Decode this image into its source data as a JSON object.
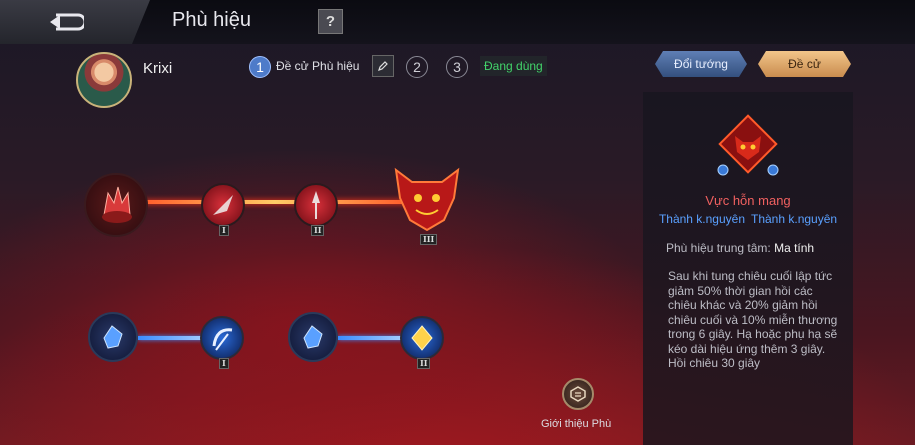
{
  "header": {
    "title": "Phù hiệu",
    "help_label": "?"
  },
  "hero": {
    "name": "Krixi"
  },
  "steps": [
    {
      "number": "1",
      "label": "Đề cử Phù hiệu",
      "active": true
    },
    {
      "number": "2"
    },
    {
      "number": "3"
    }
  ],
  "status": {
    "in_use": "Đang dùng"
  },
  "buttons": {
    "change_hero": "Đổi tướng",
    "recommend": "Đề cử"
  },
  "panel": {
    "title": "Vực hỗn mang",
    "subtitle_left": "Thành k.nguyên",
    "subtitle_right": "Thành k.nguyên",
    "center_label": "Phù hiệu trung tâm:",
    "center_value": "Ma tính",
    "description": "Sau khi tung chiêu cuối lập tức giảm 50% thời gian hồi các chiêu khác và 20% giảm hồi chiêu cuối và 10% miễn thương trong 6 giây. Hạ hoặc phụ hạ sẽ kéo dài hiệu ứng thêm 3 giây. Hồi chiêu 30 giây"
  },
  "tree": {
    "red_row": {
      "tiers": [
        "I",
        "II",
        "III"
      ],
      "icons": [
        "red-crystal-icon",
        "red-blade-icon",
        "red-spear-icon",
        "demon-emblem-icon"
      ]
    },
    "blue_row_left": {
      "tiers": [
        "I"
      ],
      "icons": [
        "blue-crystal-icon",
        "blue-scythe-icon"
      ]
    },
    "blue_row_right": {
      "tiers": [
        "II"
      ],
      "icons": [
        "blue-crystal-icon",
        "blue-gem-icon"
      ]
    }
  },
  "footer": {
    "intro_label": "Giới thiệu Phù"
  },
  "colors": {
    "red_accent": "#e03030",
    "blue_accent": "#3a8cff",
    "in_use_green": "#42d46a"
  }
}
